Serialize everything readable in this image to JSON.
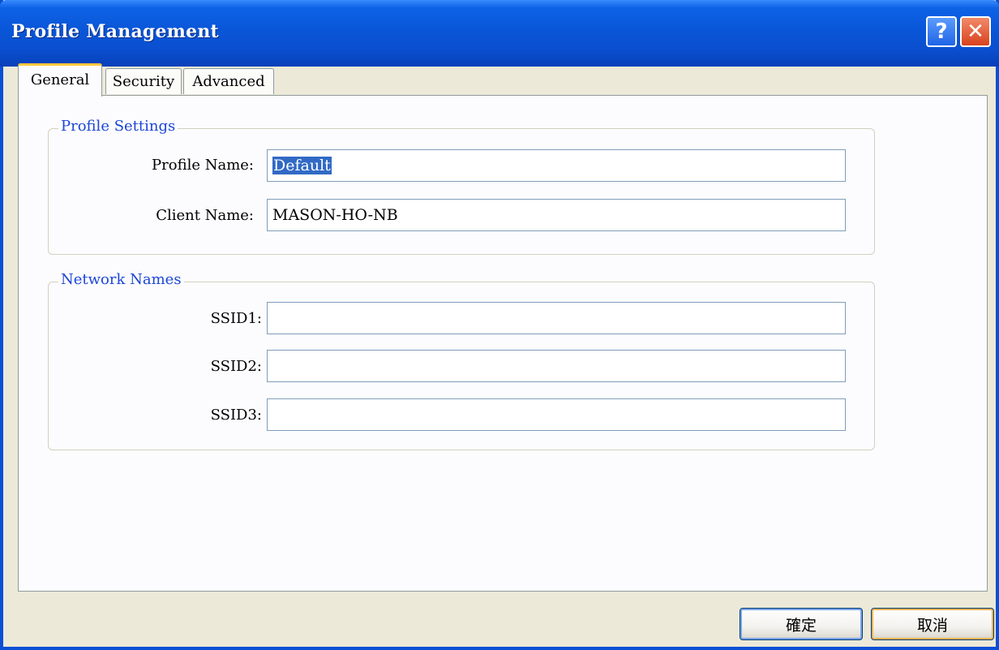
{
  "window": {
    "title": "Profile Management"
  },
  "titlebar": {
    "help_glyph": "?",
    "close_glyph": "✕"
  },
  "tabs": [
    {
      "label": "General",
      "active": true
    },
    {
      "label": "Security",
      "active": false
    },
    {
      "label": "Advanced",
      "active": false
    }
  ],
  "profile_settings": {
    "title": "Profile Settings",
    "profile_name_label": "Profile Name:",
    "profile_name_value": "Default",
    "client_name_label": "Client Name:",
    "client_name_value": "MASON-HO-NB"
  },
  "network_names": {
    "title": "Network Names",
    "ssid1_label": "SSID1:",
    "ssid1_value": "",
    "ssid2_label": "SSID2:",
    "ssid2_value": "",
    "ssid3_label": "SSID3:",
    "ssid3_value": ""
  },
  "footer": {
    "ok_label": "確定",
    "cancel_label": "取消"
  },
  "colors": {
    "titlebar_blue": "#0a56d8",
    "group_title_blue": "#1c46d6",
    "selection_blue": "#316ac5",
    "active_tab_accent": "#ffc83c"
  },
  "icons": {
    "help": "help-icon",
    "close": "close-icon"
  }
}
